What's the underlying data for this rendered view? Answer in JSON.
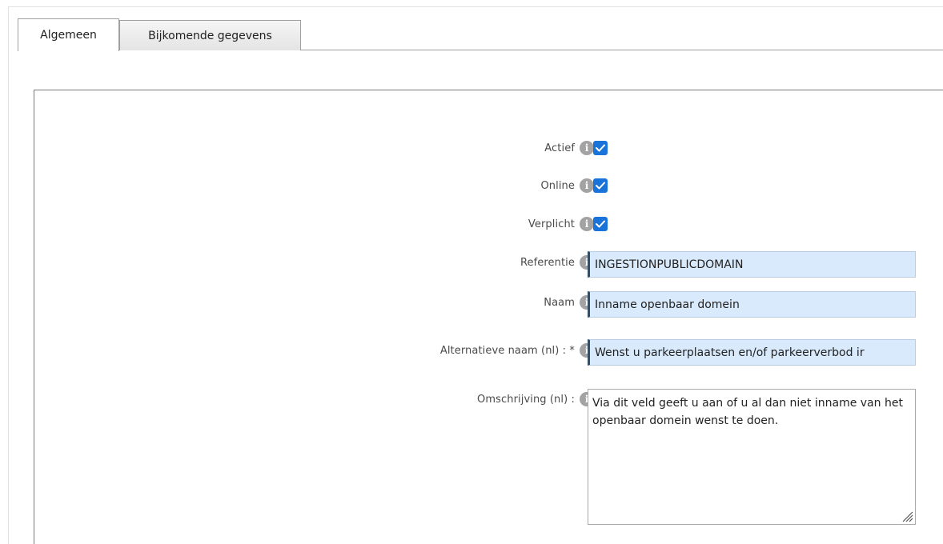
{
  "tabs": [
    {
      "label": "Algemeen",
      "active": true
    },
    {
      "label": "Bijkomende gegevens",
      "active": false
    }
  ],
  "form": {
    "actief": {
      "label": "Actief",
      "checked": true
    },
    "online": {
      "label": "Online",
      "checked": true
    },
    "verplicht": {
      "label": "Verplicht",
      "checked": true
    },
    "referentie": {
      "label": "Referentie",
      "value": "INGESTIONPUBLICDOMAIN"
    },
    "naam": {
      "label": "Naam",
      "value": "Inname openbaar domein"
    },
    "alternatieve_naam": {
      "label": "Alternatieve naam (nl) : *",
      "value": "Wenst u parkeerplaatsen en/of parkeerverbod ir"
    },
    "omschrijving": {
      "label": "Omschrijving (nl) :",
      "value": "Via dit veld geeft u aan of u al dan niet inname van het openbaar domein wenst te doen."
    }
  },
  "icons": {
    "info": "info-icon",
    "check": "checkmark-icon",
    "resize": "resize-grip-icon"
  },
  "colors": {
    "checkbox": "#1a73d8",
    "input_bg": "#d8eafc",
    "info_icon": "#a3a3a3"
  }
}
